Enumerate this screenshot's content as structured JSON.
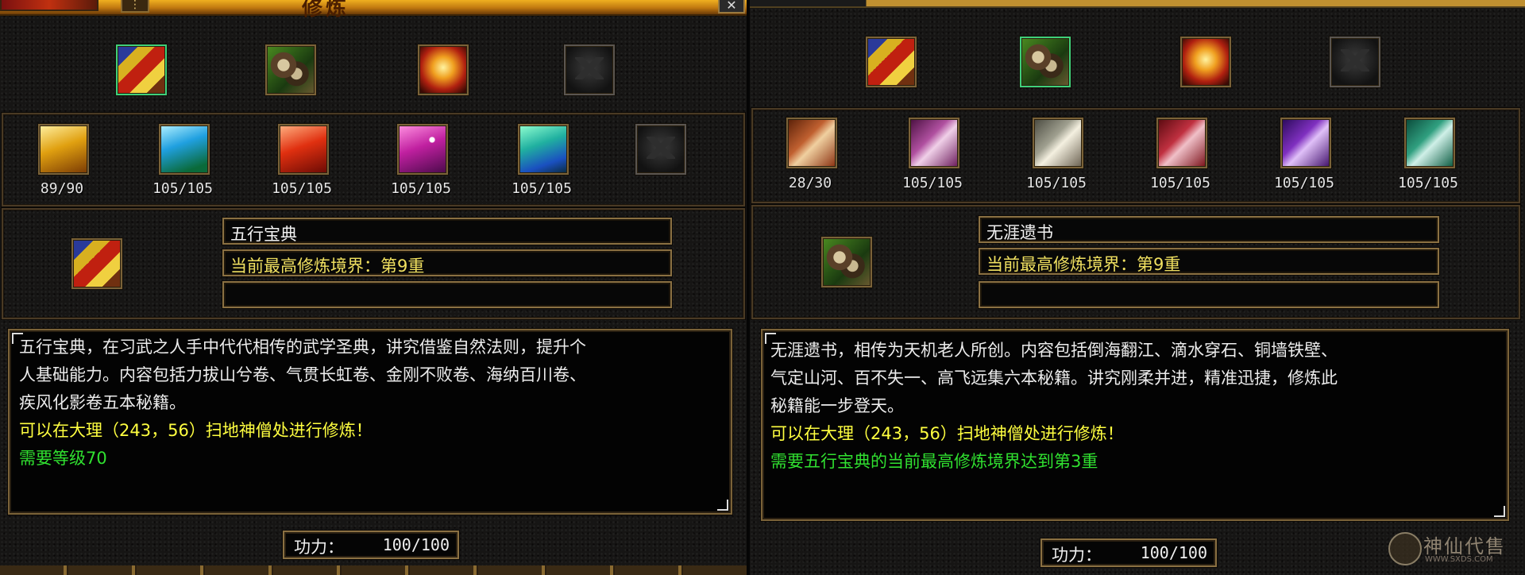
{
  "left": {
    "title": "修炼",
    "title_menu_icon": "menu-icon",
    "close_icon": "✕",
    "top_icons": [
      {
        "name": "wuxing-book",
        "icon": "book-icon",
        "selected": true
      },
      {
        "name": "wuya-scroll",
        "icon": "scroll-bundle-icon",
        "selected": false
      },
      {
        "name": "golden-scroll",
        "icon": "golden-scroll-icon",
        "selected": false
      },
      {
        "name": "empty-slot",
        "icon": "empty-slot-icon",
        "selected": false
      }
    ],
    "sub_icons": [
      {
        "icon": "yellow-book-icon",
        "count": "89/90"
      },
      {
        "icon": "blue-book-icon",
        "count": "105/105"
      },
      {
        "icon": "red-book-icon",
        "count": "105/105"
      },
      {
        "icon": "pink-book-icon",
        "count": "105/105"
      },
      {
        "icon": "teal-book-icon",
        "count": "105/105"
      },
      {
        "icon": "empty-slot-icon",
        "count": ""
      }
    ],
    "name": "五行宝典",
    "realm": "当前最高修炼境界：第9重",
    "extra": "",
    "desc_lines": [
      "五行宝典，在习武之人手中代代相传的武学圣典，讲究借鉴自然法则，提升个",
      "人基础能力。内容包括力拔山兮卷、气贯长虹卷、金刚不败卷、海纳百川卷、",
      "疾风化影卷五本秘籍。"
    ],
    "location": "可以在大理（243，56）扫地神僧处进行修炼！",
    "requirement": "需要等级70",
    "power_label": "功力：",
    "power_value": "100/100"
  },
  "right": {
    "top_icons": [
      {
        "name": "wuxing-book",
        "icon": "book-icon",
        "selected": false
      },
      {
        "name": "wuya-scroll",
        "icon": "scroll-bundle-icon",
        "selected": true
      },
      {
        "name": "golden-scroll",
        "icon": "golden-scroll-icon",
        "selected": false
      },
      {
        "name": "empty-slot",
        "icon": "empty-slot-icon",
        "selected": false
      }
    ],
    "sub_icons": [
      {
        "icon": "orange-scroll-icon",
        "count": "28/30"
      },
      {
        "icon": "purple-scroll-icon",
        "count": "105/105"
      },
      {
        "icon": "white-scroll-icon",
        "count": "105/105"
      },
      {
        "icon": "red-scroll-icon",
        "count": "105/105"
      },
      {
        "icon": "violet-scroll-icon",
        "count": "105/105"
      },
      {
        "icon": "green-scroll-icon",
        "count": "105/105"
      }
    ],
    "name": "无涯遗书",
    "realm": "当前最高修炼境界：第9重",
    "extra": "",
    "desc_lines": [
      "无涯遗书，相传为天机老人所创。内容包括倒海翻江、滴水穿石、铜墙铁壁、",
      "气定山河、百不失一、高飞远集六本秘籍。讲究刚柔并进，精准迅捷，修炼此",
      "秘籍能一步登天。"
    ],
    "location": "可以在大理（243，56）扫地神僧处进行修炼！",
    "requirement": "需要五行宝典的当前最高修炼境界达到第3重",
    "power_label": "功力：",
    "power_value": "100/100"
  },
  "watermark": {
    "name": "神仙代售",
    "url": "WWW.SXDS.COM"
  },
  "colors": {
    "gold_text": "#f0e060",
    "yellow_text": "#ffff40",
    "green_text": "#30e030",
    "selected_border": "#3fd07a"
  }
}
